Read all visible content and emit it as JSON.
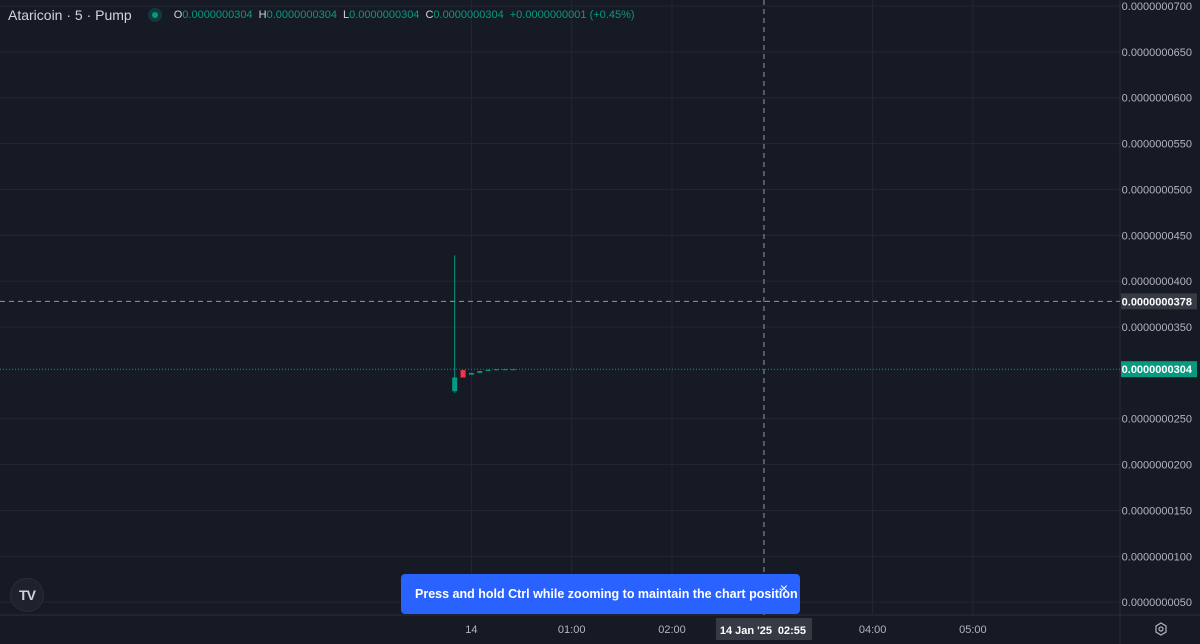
{
  "legend": {
    "title": "Ataricoin · 5 · Pump",
    "open_key": "O",
    "open": "0.0000000304",
    "high_key": "H",
    "high": "0.0000000304",
    "low_key": "L",
    "low": "0.0000000304",
    "close_key": "C",
    "close": "0.0000000304",
    "change": "+0.0000000001 (+0.45%)"
  },
  "logo": {
    "text": "TV"
  },
  "toast": {
    "text": "Press and hold Ctrl while zooming to maintain the chart position",
    "close_icon": "×"
  },
  "colors": {
    "background": "#161a25",
    "grid": "#232733",
    "up": "#089981",
    "down": "#f23645",
    "accent": "#2962ff"
  },
  "chart_data": {
    "type": "candlestick",
    "y_tick_labels": [
      "0.0000000700",
      "0.0000000650",
      "0.0000000600",
      "0.0000000550",
      "0.0000000500",
      "0.0000000450",
      "0.0000000400",
      "0.0000000350",
      "0.0000000250",
      "0.0000000200",
      "0.0000000150",
      "0.0000000100",
      "0.0000000050"
    ],
    "y_ticks": [
      7e-08,
      6.5e-08,
      6e-08,
      5.5e-08,
      5e-08,
      4.5e-08,
      4e-08,
      3.5e-08,
      2.5e-08,
      2e-08,
      1.5e-08,
      1e-08,
      5e-09
    ],
    "ylim": [
      3.6e-09,
      7e-08
    ],
    "x_ticks": [
      {
        "t": 0,
        "label": "14"
      },
      {
        "t": 60,
        "label": "01:00"
      },
      {
        "t": 120,
        "label": "02:00"
      },
      {
        "t": 240,
        "label": "04:00"
      },
      {
        "t": 300,
        "label": "05:00"
      }
    ],
    "xlim": [
      -282,
      388
    ],
    "candles": [
      {
        "t": -10,
        "open": 2.8e-08,
        "high": 4.28e-08,
        "low": 2.78e-08,
        "close": 2.95e-08
      },
      {
        "t": -5,
        "open": 3.03e-08,
        "high": 3.03e-08,
        "low": 2.95e-08,
        "close": 2.95e-08
      },
      {
        "t": 0,
        "open": 2.98e-08,
        "high": 3e-08,
        "low": 2.98e-08,
        "close": 3e-08
      },
      {
        "t": 5,
        "open": 3e-08,
        "high": 3.02e-08,
        "low": 3e-08,
        "close": 3.02e-08
      },
      {
        "t": 10,
        "open": 3.02e-08,
        "high": 3.04e-08,
        "low": 3.02e-08,
        "close": 3.03e-08
      },
      {
        "t": 15,
        "open": 3.03e-08,
        "high": 3.04e-08,
        "low": 3.03e-08,
        "close": 3.04e-08
      },
      {
        "t": 20,
        "open": 3.04e-08,
        "high": 3.04e-08,
        "low": 3.04e-08,
        "close": 3.04e-08
      },
      {
        "t": 25,
        "open": 3.04e-08,
        "high": 3.04e-08,
        "low": 3.04e-08,
        "close": 3.04e-08
      }
    ],
    "last_price": 3.04e-08,
    "last_price_label": "0.0000000304",
    "crosshair": {
      "price": 3.78e-08,
      "price_label": "0.0000000378",
      "t": 175,
      "time_label_date": "14 Jan '25",
      "time_label_time": "02:55"
    }
  }
}
